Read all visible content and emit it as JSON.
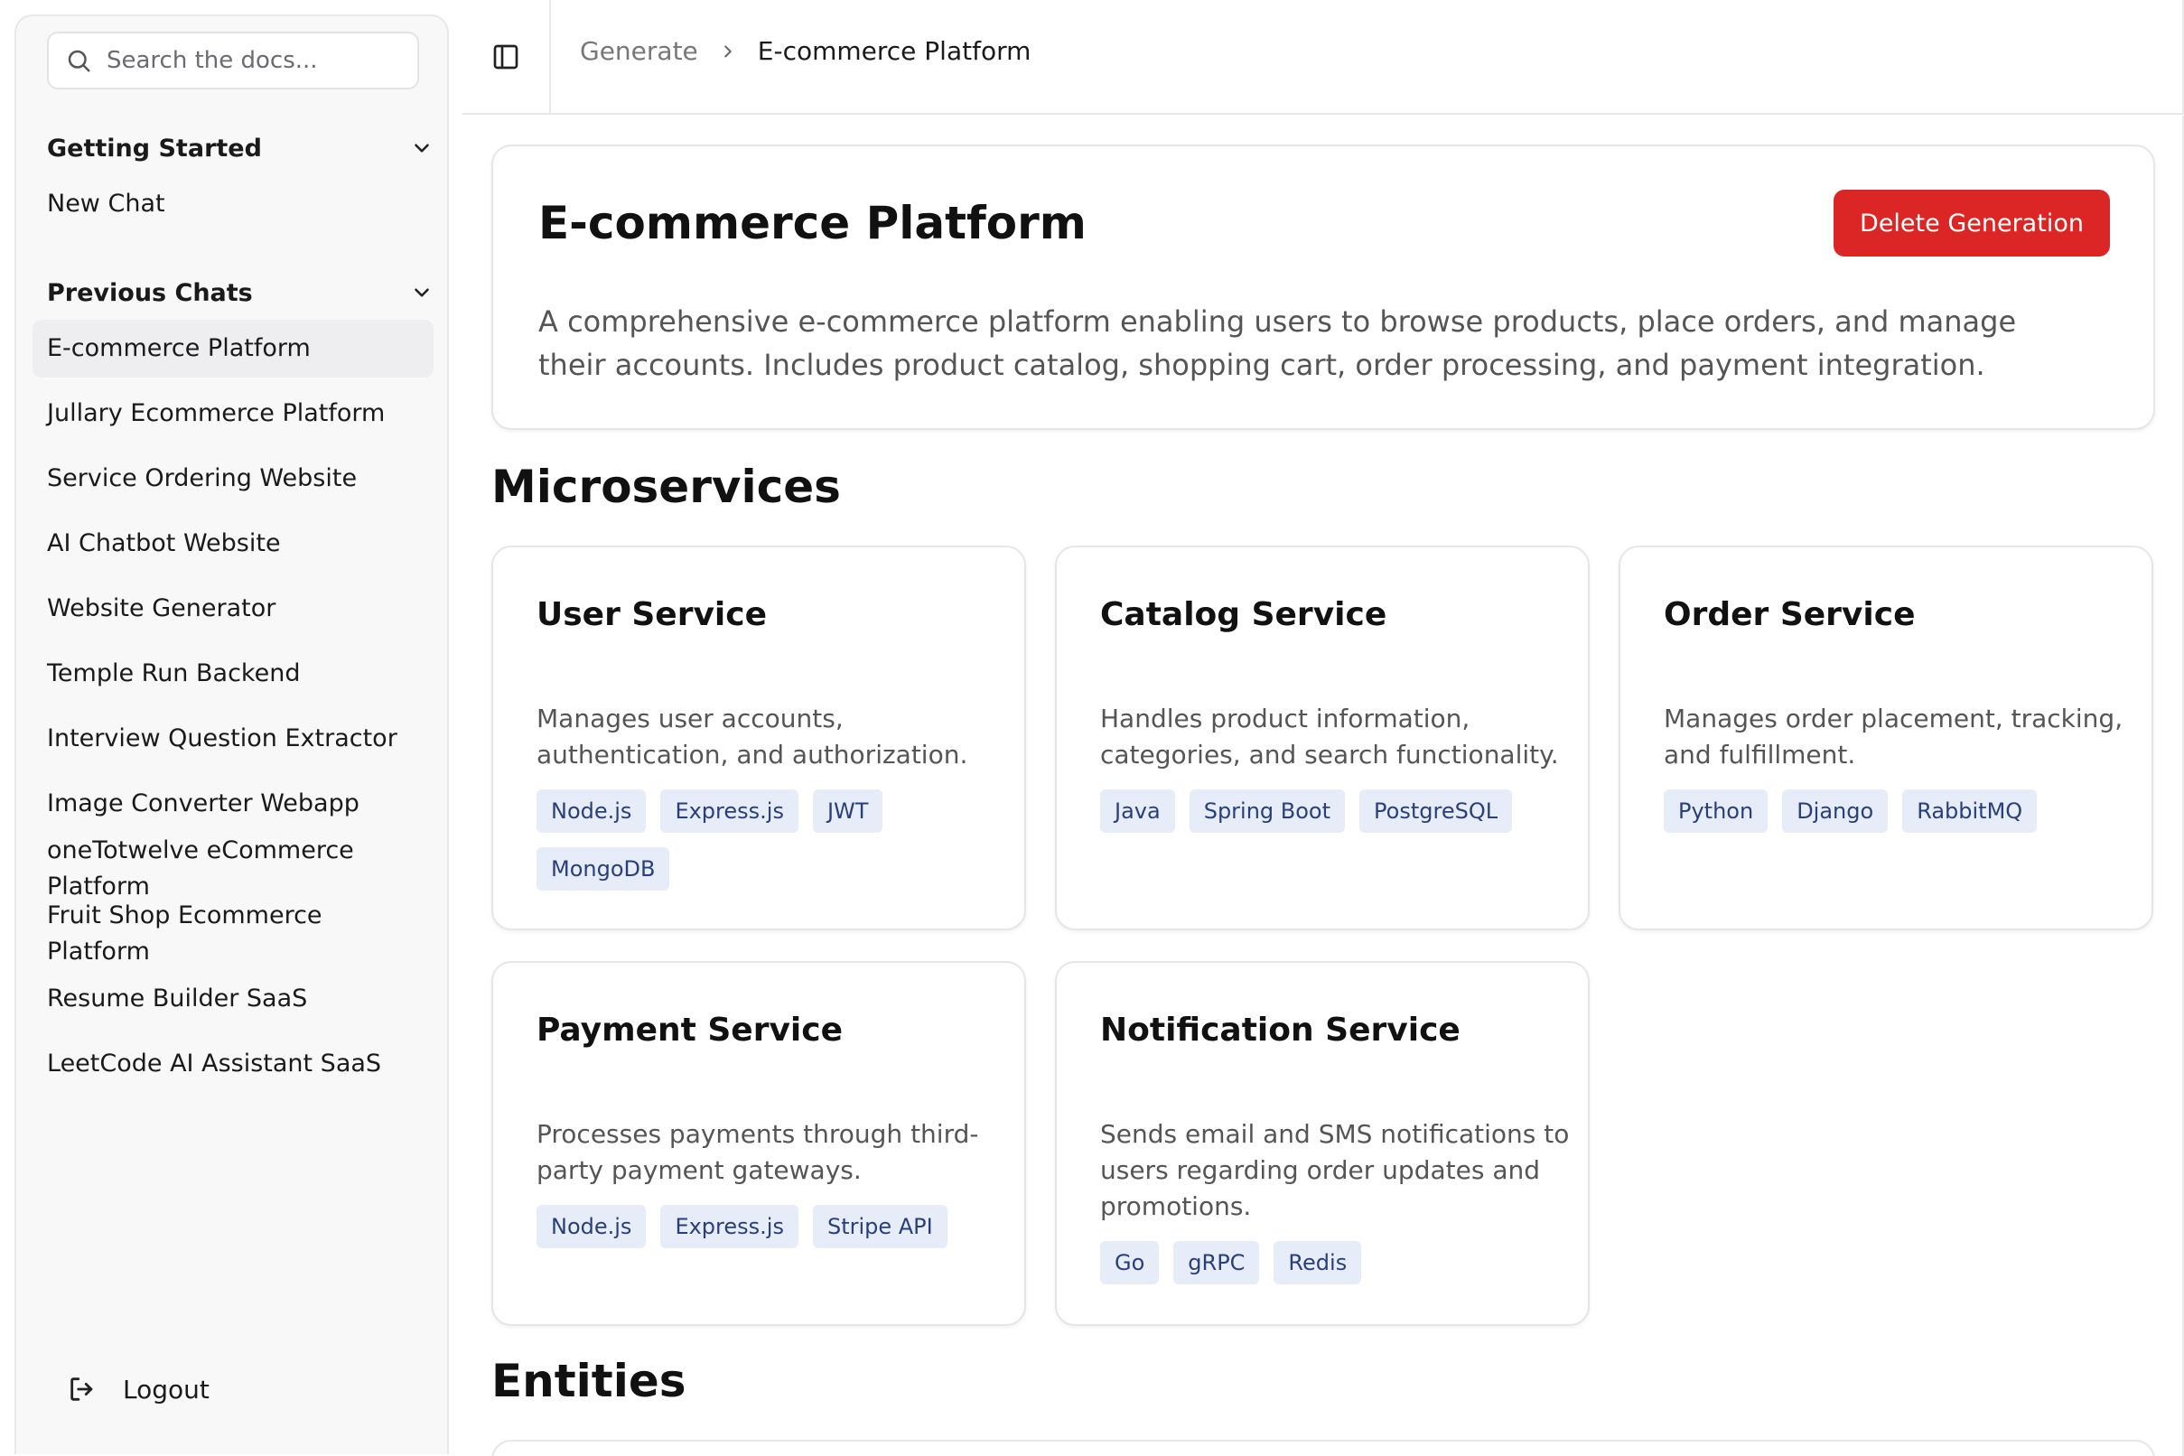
{
  "sidebar": {
    "search": {
      "placeholder": "Search the docs..."
    },
    "getting_started": {
      "title": "Getting Started",
      "items": [
        {
          "label": "New Chat"
        }
      ]
    },
    "previous_chats": {
      "title": "Previous Chats",
      "items": [
        {
          "label": "E-commerce Platform",
          "active": true
        },
        {
          "label": "Jullary Ecommerce Platform"
        },
        {
          "label": "Service Ordering Website"
        },
        {
          "label": "AI Chatbot Website"
        },
        {
          "label": "Website Generator"
        },
        {
          "label": "Temple Run Backend"
        },
        {
          "label": "Interview Question Extractor"
        },
        {
          "label": "Image Converter Webapp"
        },
        {
          "label": "oneTotwelve eCommerce Platform"
        },
        {
          "label": "Fruit Shop Ecommerce Platform"
        },
        {
          "label": "Resume Builder SaaS"
        },
        {
          "label": "LeetCode AI Assistant SaaS"
        }
      ]
    },
    "logout_label": "Logout"
  },
  "breadcrumb": {
    "parent": "Generate",
    "current": "E-commerce Platform"
  },
  "generation": {
    "title": "E-commerce Platform",
    "delete_label": "Delete Generation",
    "description": "A comprehensive e-commerce platform enabling users to browse products, place orders, and manage their accounts. Includes product catalog, shopping cart, order processing, and payment integration."
  },
  "microservices": {
    "heading": "Microservices",
    "items": [
      {
        "name": "User Service",
        "description": "Manages user accounts, authentication, and authorization.",
        "tags": [
          "Node.js",
          "Express.js",
          "JWT",
          "MongoDB"
        ]
      },
      {
        "name": "Catalog Service",
        "description": "Handles product information, categories, and search functionality.",
        "tags": [
          "Java",
          "Spring Boot",
          "PostgreSQL"
        ]
      },
      {
        "name": "Order Service",
        "description": "Manages order placement, tracking, and fulfillment.",
        "tags": [
          "Python",
          "Django",
          "RabbitMQ"
        ]
      },
      {
        "name": "Payment Service",
        "description": "Processes payments through third-party payment gateways.",
        "tags": [
          "Node.js",
          "Express.js",
          "Stripe API"
        ]
      },
      {
        "name": "Notification Service",
        "description": "Sends email and SMS notifications to users regarding order updates and promotions.",
        "tags": [
          "Go",
          "gRPC",
          "Redis"
        ]
      }
    ]
  },
  "entities": {
    "heading": "Entities"
  },
  "colors": {
    "accent_danger": "#dc2626",
    "tag_bg": "#e6edf8",
    "tag_text": "#2a3f7a"
  }
}
